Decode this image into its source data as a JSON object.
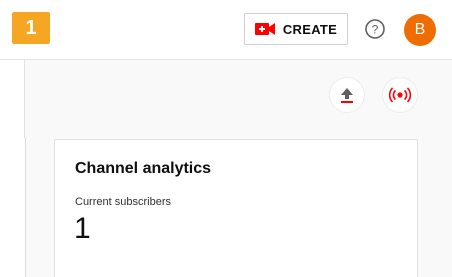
{
  "step": {
    "number": "1"
  },
  "header": {
    "create_label": "CREATE",
    "create_icon": "video-camera-plus-icon",
    "help_icon": "help-circle-icon",
    "avatar_letter": "B",
    "avatar_color": "#ef6c00"
  },
  "toolbar": {
    "upload_icon": "upload-icon",
    "live_icon": "go-live-icon"
  },
  "channel_analytics": {
    "title": "Channel analytics",
    "subscribers_label": "Current subscribers",
    "subscribers_value": "1"
  },
  "colors": {
    "step_badge": "#f5a623",
    "accent_red": "#ff0000"
  }
}
